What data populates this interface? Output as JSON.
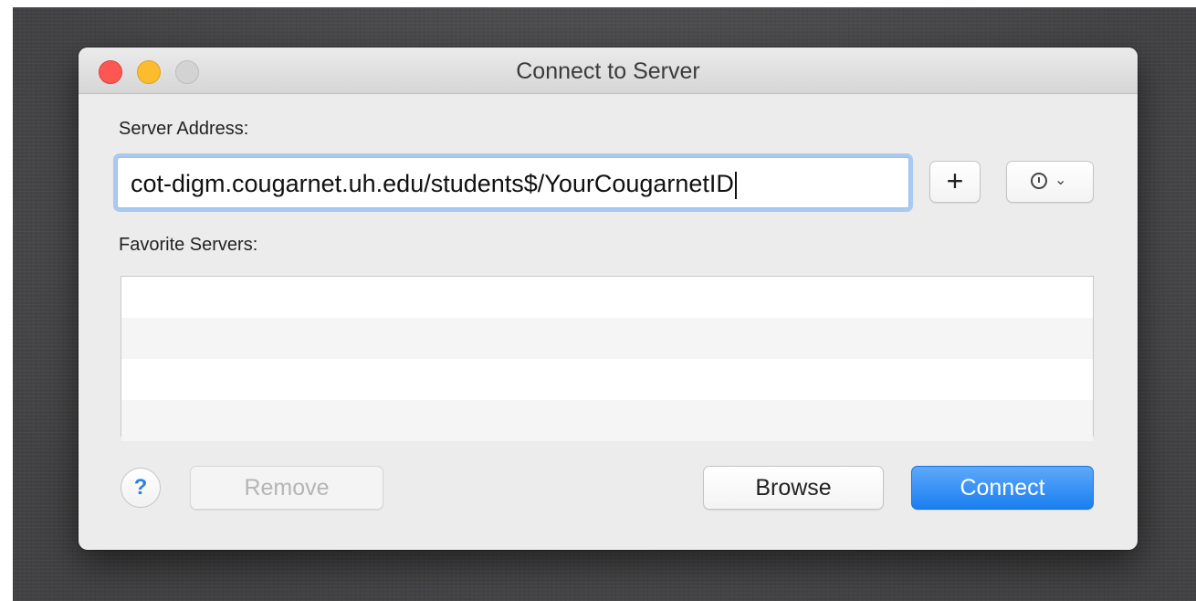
{
  "window": {
    "title": "Connect to Server"
  },
  "server_address": {
    "label": "Server Address:",
    "value": "cot-digm.cougarnet.uh.edu/students$/YourCougarnetID"
  },
  "toolbar": {
    "add_label": "+",
    "recent_icon": "clock-icon",
    "recent_chevron": "⌄"
  },
  "favorites": {
    "label": "Favorite Servers:",
    "rows": [
      "",
      "",
      "",
      ""
    ]
  },
  "footer": {
    "help_label": "?",
    "remove_label": "Remove",
    "browse_label": "Browse",
    "connect_label": "Connect"
  },
  "colors": {
    "accent": "#1a7ff0",
    "close": "#fc5753",
    "minimize": "#fdbc2e",
    "zoom": "#d3d3d3"
  }
}
